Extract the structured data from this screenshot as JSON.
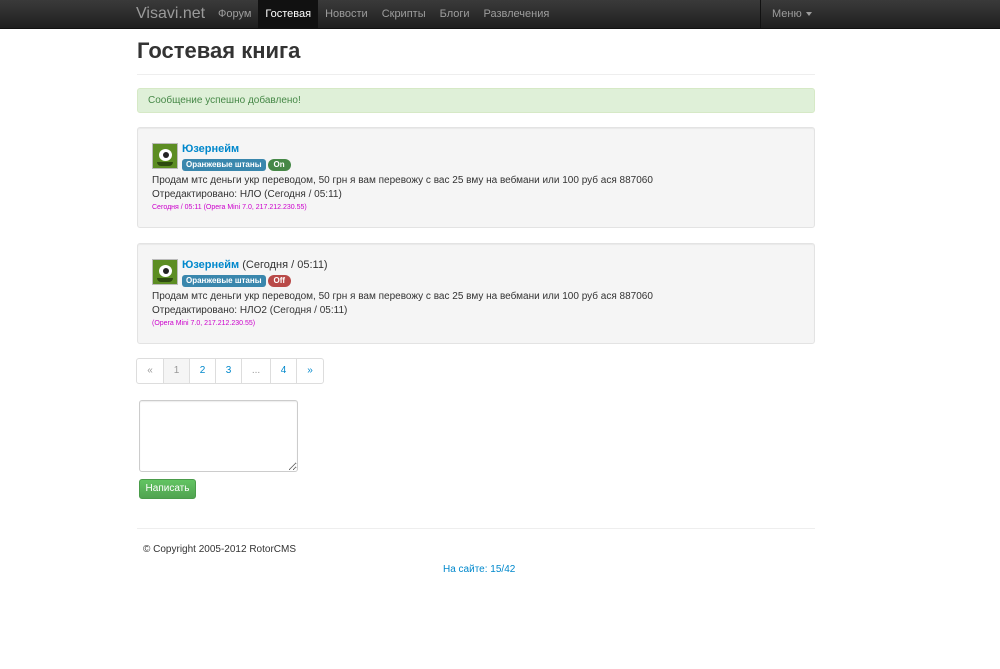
{
  "navbar": {
    "brand": "Visavi.net",
    "items": [
      {
        "label": "Форум",
        "active": false
      },
      {
        "label": "Гостевая",
        "active": true
      },
      {
        "label": "Новости",
        "active": false
      },
      {
        "label": "Скрипты",
        "active": false
      },
      {
        "label": "Блоги",
        "active": false
      },
      {
        "label": "Развлечения",
        "active": false
      }
    ],
    "menu_label": "Меню"
  },
  "page": {
    "title": "Гостевая книга",
    "alert": "Сообщение успешно добавлено!"
  },
  "posts": [
    {
      "username": "Юзернейм",
      "time": "",
      "role": "Оранжевые штаны",
      "status": "On",
      "text": "Продам мтс деньги укр переводом, 50 грн я вам перевожу с вас 25 вму на вебмани или 100 руб ася 887060",
      "edited": "Отредактировано: НЛО (Сегодня / 05:11)",
      "meta": "Сегодня / 05:11 (Opera Mini 7.0, 217.212.230.55)"
    },
    {
      "username": "Юзернейм",
      "time": "(Сегодня / 05:11)",
      "role": "Оранжевые штаны",
      "status": "Off",
      "text": "Продам мтс деньги укр переводом, 50 грн я вам перевожу с вас 25 вму на вебмани или 100 руб ася 887060",
      "edited": "Отредактировано: НЛО2 (Сегодня / 05:11)",
      "meta": "(Opera Mini 7.0, 217.212.230.55)"
    }
  ],
  "pagination": [
    "«",
    "1",
    "2",
    "3",
    "...",
    "4",
    "»"
  ],
  "pagination_current": "1",
  "form": {
    "textarea_value": "",
    "submit_label": "Написать"
  },
  "footer": {
    "copyright": "© Copyright 2005-2012 RotorCMS",
    "online": "На сайте: 15/42"
  },
  "colors": {
    "link": "#0088cc",
    "alert_bg": "#dff0d8",
    "alert_text": "#468847",
    "badge_on": "#468847",
    "badge_off": "#b94a48",
    "label_info": "#3a87ad",
    "meta_text": "#cc00cc",
    "submit_bg": "#5bb75b"
  }
}
